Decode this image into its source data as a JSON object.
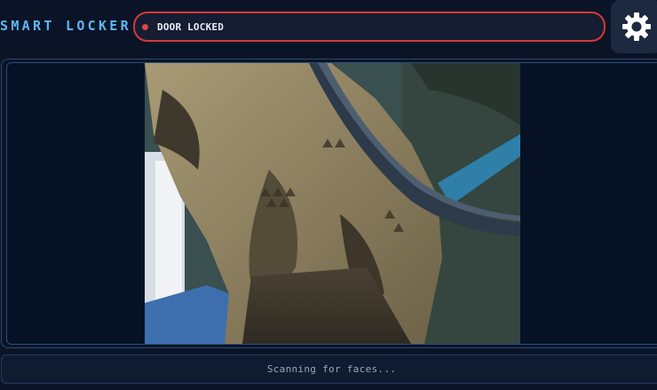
{
  "app": {
    "title": "SMART LOCKER"
  },
  "status": {
    "text": "DOOR LOCKED",
    "color": "#d83838"
  },
  "settings": {
    "icon": "gear-icon"
  },
  "camera": {
    "feed_description_icon": "camera-feed"
  },
  "footer": {
    "message": "Scanning for faces..."
  },
  "colors": {
    "background": "#0b1427",
    "accent": "#5fb6f5",
    "status_locked": "#d83838"
  }
}
